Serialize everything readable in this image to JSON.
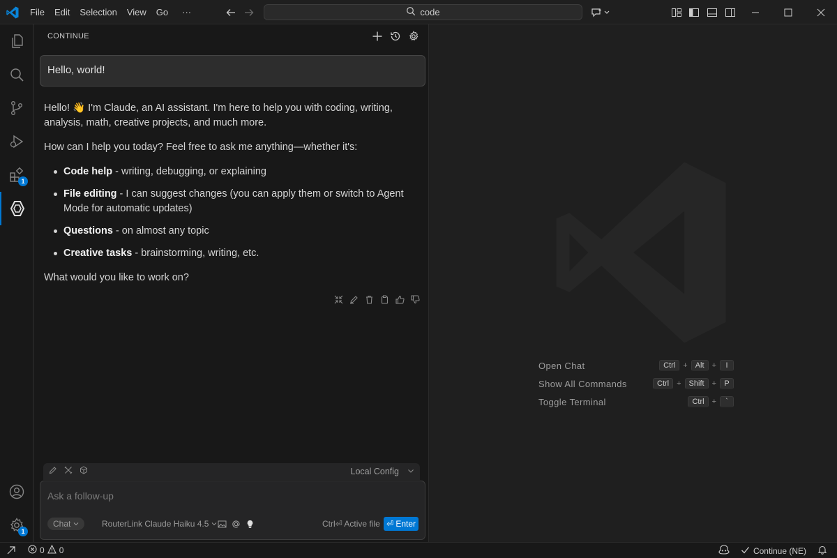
{
  "titlebar": {
    "menu": [
      "File",
      "Edit",
      "Selection",
      "View",
      "Go",
      "···"
    ],
    "search_text": "code"
  },
  "activity": {
    "extensions_badge": "1",
    "settings_badge": "1"
  },
  "panel": {
    "title": "CONTINUE"
  },
  "chat": {
    "user_message": "Hello, world!",
    "intro": "Hello! 👋 I'm Claude, an AI assistant. I'm here to help you with coding, writing, analysis, math, creative projects, and much more.",
    "question": "How can I help you today? Feel free to ask me anything—whether it's:",
    "bullets": [
      {
        "bold": "Code help",
        "text": " - writing, debugging, or explaining"
      },
      {
        "bold": "File editing",
        "text": " - I can suggest changes (you can apply them or switch to Agent Mode for automatic updates)"
      },
      {
        "bold": "Questions",
        "text": " - on almost any topic"
      },
      {
        "bold": "Creative tasks",
        "text": " - brainstorming, writing, etc."
      }
    ],
    "closing": "What would you like to work on?"
  },
  "composer": {
    "config_label": "Local Config",
    "placeholder": "Ask a follow-up",
    "mode": "Chat",
    "model": "RouterLink Claude Haiku 4.5",
    "active_file_hint": "Ctrl⏎ Active file",
    "enter_label": "⏎ Enter"
  },
  "shortcuts": [
    {
      "label": "Open Chat",
      "keys": [
        "Ctrl",
        "Alt",
        "I"
      ]
    },
    {
      "label": "Show All Commands",
      "keys": [
        "Ctrl",
        "Shift",
        "P"
      ]
    },
    {
      "label": "Toggle Terminal",
      "keys": [
        "Ctrl",
        "`"
      ]
    }
  ],
  "statusbar": {
    "errors": "0",
    "warnings": "0",
    "continue_label": "Continue (NE)"
  }
}
